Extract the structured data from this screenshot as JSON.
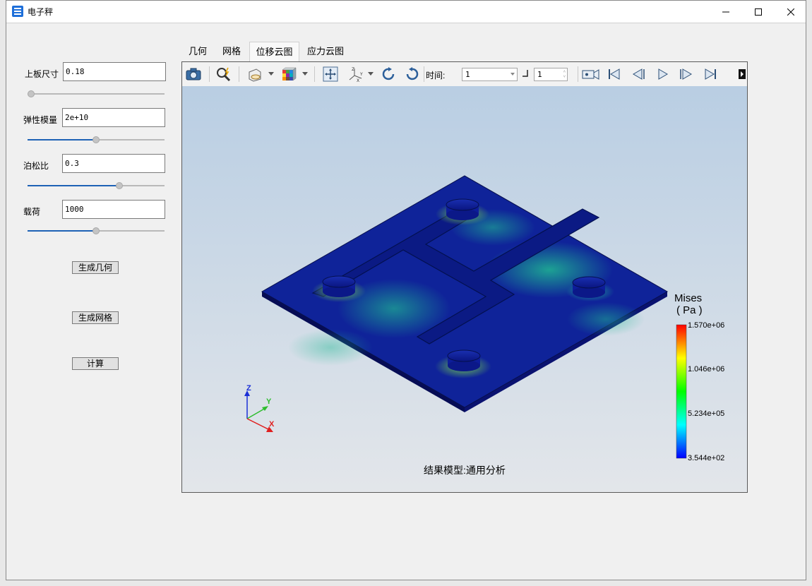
{
  "window": {
    "title": "电子秤"
  },
  "params": {
    "plate_size": {
      "label": "上板尺寸",
      "value": "0.18",
      "slider_fraction": 0.0
    },
    "elastic_modulus": {
      "label": "弹性模量",
      "value": "2e+10",
      "slider_fraction": 0.5
    },
    "poisson_ratio": {
      "label": "泊松比",
      "value": "0.3",
      "slider_fraction": 0.67
    },
    "load": {
      "label": "载荷",
      "value": "1000",
      "slider_fraction": 0.5
    }
  },
  "buttons": {
    "generate_geometry": "生成几何",
    "generate_mesh": "生成网格",
    "compute": "计算"
  },
  "tabs": [
    {
      "label": "几何",
      "active": false
    },
    {
      "label": "网格",
      "active": false
    },
    {
      "label": "位移云图",
      "active": true
    },
    {
      "label": "应力云图",
      "active": false
    }
  ],
  "toolbar": {
    "icons": [
      "camera-icon",
      "zoom-icon",
      "display-mode-icon",
      "color-cube-icon",
      "fit-view-icon",
      "axis-orient-icon",
      "rotate-left-icon",
      "rotate-right-icon",
      "record-icon",
      "first-frame-icon",
      "prev-frame-icon",
      "play-icon",
      "next-frame-icon",
      "last-frame-icon"
    ],
    "time_label": "时间:",
    "time_value": "1",
    "step_value": "1"
  },
  "legend": {
    "title": "Mises",
    "unit": "( Pa )",
    "ticks": [
      "1.570e+06",
      "1.046e+06",
      "5.234e+05",
      "3.544e+02"
    ],
    "colors": [
      "#ff0000",
      "#ffff00",
      "#00ff00",
      "#00ffff",
      "#0000ff"
    ]
  },
  "axes": {
    "z": "Z",
    "y": "Y",
    "x": "X"
  },
  "caption": "结果模型:通用分析"
}
